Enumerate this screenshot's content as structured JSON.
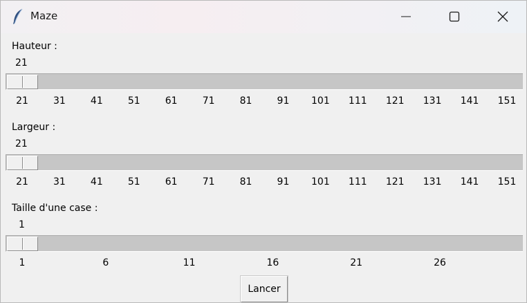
{
  "window": {
    "title": "Maze",
    "icon": "feather-icon",
    "controls": [
      "minimize-icon",
      "maximize-icon",
      "close-icon"
    ]
  },
  "sliders": [
    {
      "label": "Hauteur :",
      "value": "21",
      "min": 21,
      "max": 151,
      "ticks": [
        "21",
        "31",
        "41",
        "51",
        "61",
        "71",
        "81",
        "91",
        "101",
        "111",
        "121",
        "131",
        "141",
        "151"
      ]
    },
    {
      "label": "Largeur :",
      "value": "21",
      "min": 21,
      "max": 151,
      "ticks": [
        "21",
        "31",
        "41",
        "51",
        "61",
        "71",
        "81",
        "91",
        "101",
        "111",
        "121",
        "131",
        "141",
        "151"
      ]
    },
    {
      "label": "Taille d'une case :",
      "value": "1",
      "min": 1,
      "max": 30,
      "ticks": [
        "1",
        "6",
        "11",
        "16",
        "21",
        "26"
      ]
    }
  ],
  "launch_button": {
    "label": "Lancer"
  },
  "colors": {
    "window_bg": "#f0f0f0",
    "trough": "#c6c6c6"
  }
}
